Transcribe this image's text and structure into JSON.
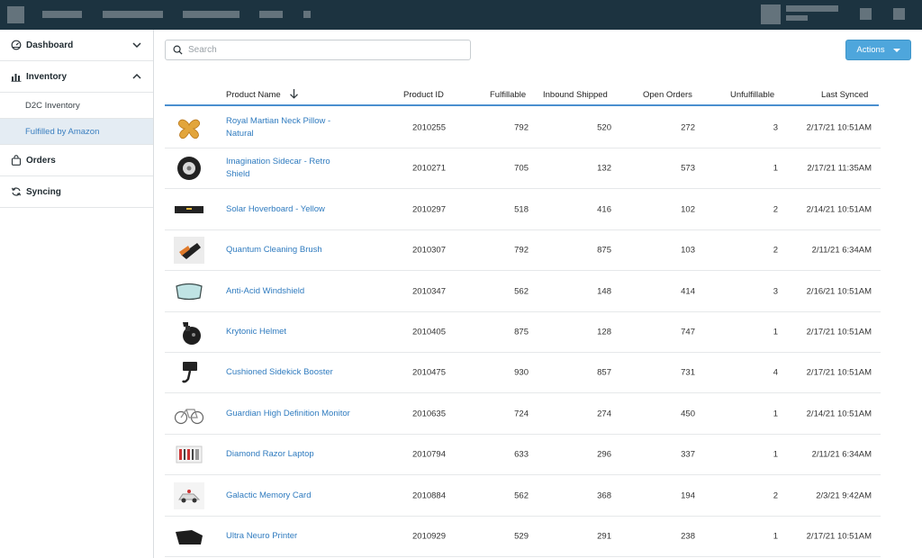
{
  "sidebar": {
    "items": [
      {
        "label": "Dashboard",
        "icon": "dashboard-gauge-icon",
        "chevron": "chevron-down-icon"
      },
      {
        "label": "Inventory",
        "icon": "bar-chart-icon",
        "chevron": "chevron-up-icon"
      },
      {
        "label": "Orders",
        "icon": "shopping-bag-icon"
      },
      {
        "label": "Syncing",
        "icon": "sync-arrows-icon"
      }
    ],
    "sub_items": [
      {
        "label": "D2C Inventory",
        "active": false
      },
      {
        "label": "Fulfilled by Amazon",
        "active": true
      }
    ]
  },
  "search": {
    "placeholder": "Search",
    "value": ""
  },
  "actions_label": "Actions",
  "colors": {
    "topbar": "#1c3340",
    "accent": "#4ea6dc",
    "link": "#2f7bbf",
    "active_nav_bg": "#e4ecf3"
  },
  "table": {
    "columns": [
      "Product Name",
      "Product ID",
      "Fulfillable",
      "Inbound Shipped",
      "Open Orders",
      "Unfulfillable",
      "Last Synced"
    ],
    "sort_icon": "arrow-down-icon",
    "rows": [
      {
        "name": "Royal Martian Neck Pillow - Natural",
        "id": "2010255",
        "fulfillable": "792",
        "inbound": "520",
        "open": "272",
        "unfulfillable": "3",
        "synced": "2/17/21 10:51AM",
        "thumb": "neck-pillow-image"
      },
      {
        "name": "Imagination Sidecar - Retro Shield",
        "id": "2010271",
        "fulfillable": "705",
        "inbound": "132",
        "open": "573",
        "unfulfillable": "1",
        "synced": "2/17/21 11:35AM",
        "thumb": "tire-image"
      },
      {
        "name": "Solar Hoverboard - Yellow",
        "id": "2010297",
        "fulfillable": "518",
        "inbound": "416",
        "open": "102",
        "unfulfillable": "2",
        "synced": "2/14/21 10:51AM",
        "thumb": "hoverboard-image"
      },
      {
        "name": "Quantum Cleaning Brush",
        "id": "2010307",
        "fulfillable": "792",
        "inbound": "875",
        "open": "103",
        "unfulfillable": "2",
        "synced": "2/11/21 6:34AM",
        "thumb": "brush-image"
      },
      {
        "name": "Anti-Acid Windshield",
        "id": "2010347",
        "fulfillable": "562",
        "inbound": "148",
        "open": "414",
        "unfulfillable": "3",
        "synced": "2/16/21 10:51AM",
        "thumb": "windshield-image"
      },
      {
        "name": "Krytonic Helmet",
        "id": "2010405",
        "fulfillable": "875",
        "inbound": "128",
        "open": "747",
        "unfulfillable": "1",
        "synced": "2/17/21 10:51AM",
        "thumb": "helmet-image"
      },
      {
        "name": "Cushioned Sidekick Booster",
        "id": "2010475",
        "fulfillable": "930",
        "inbound": "857",
        "open": "731",
        "unfulfillable": "4",
        "synced": "2/17/21 10:51AM",
        "thumb": "phone-mount-image"
      },
      {
        "name": "Guardian High Definition Monitor",
        "id": "2010635",
        "fulfillable": "724",
        "inbound": "274",
        "open": "450",
        "unfulfillable": "1",
        "synced": "2/14/21 10:51AM",
        "thumb": "bicycle-image"
      },
      {
        "name": "Diamond Razor Laptop",
        "id": "2010794",
        "fulfillable": "633",
        "inbound": "296",
        "open": "337",
        "unfulfillable": "1",
        "synced": "2/11/21 6:34AM",
        "thumb": "toolset-image"
      },
      {
        "name": "Galactic Memory Card",
        "id": "2010884",
        "fulfillable": "562",
        "inbound": "368",
        "open": "194",
        "unfulfillable": "2",
        "synced": "2/3/21 9:42AM",
        "thumb": "toy-car-image"
      },
      {
        "name": "Ultra Neuro Printer",
        "id": "2010929",
        "fulfillable": "529",
        "inbound": "291",
        "open": "238",
        "unfulfillable": "1",
        "synced": "2/17/21 10:51AM",
        "thumb": "floor-mat-image"
      }
    ]
  }
}
